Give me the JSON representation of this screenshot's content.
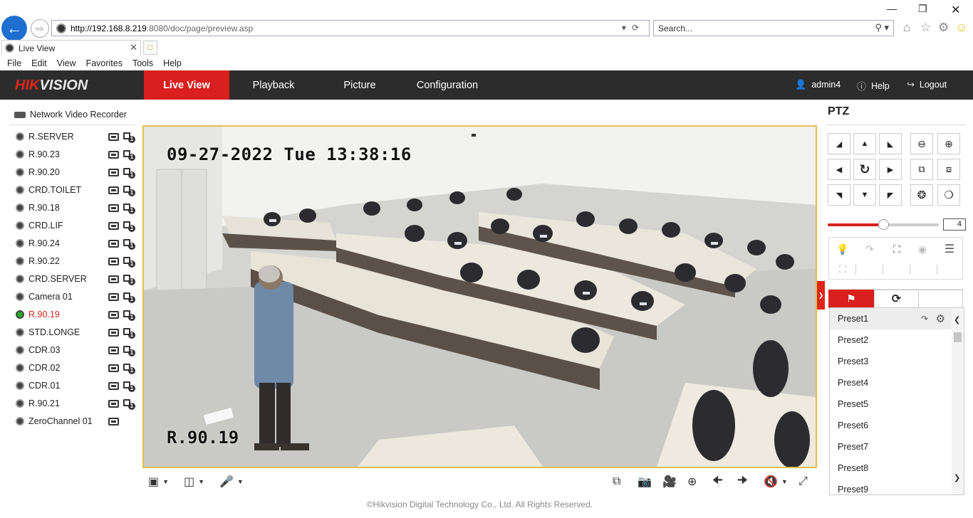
{
  "browser": {
    "url_host": "http://192.168.8.219",
    "url_rest": ":8080/doc/page/preview.asp",
    "search_placeholder": "Search...",
    "tab_title": "Live View",
    "menu": [
      "File",
      "Edit",
      "View",
      "Favorites",
      "Tools",
      "Help"
    ]
  },
  "header": {
    "logo_hik": "HIK",
    "logo_vision": "VISION",
    "tabs": [
      "Live View",
      "Playback",
      "Picture",
      "Configuration"
    ],
    "user": "admin4",
    "help": "Help",
    "logout": "Logout"
  },
  "device_tree": {
    "root": "Network Video Recorder",
    "cameras": [
      {
        "name": "R.SERVER",
        "active": false
      },
      {
        "name": "R.90.23",
        "active": false
      },
      {
        "name": "R.90.20",
        "active": false
      },
      {
        "name": "CRD.TOILET",
        "active": false
      },
      {
        "name": "R.90.18",
        "active": false
      },
      {
        "name": "CRD.LIF",
        "active": false
      },
      {
        "name": "R.90.24",
        "active": false
      },
      {
        "name": "R.90.22",
        "active": false
      },
      {
        "name": "CRD.SERVER",
        "active": false
      },
      {
        "name": "Camera 01",
        "active": false
      },
      {
        "name": "R.90.19",
        "active": true
      },
      {
        "name": "STD.LONGE",
        "active": false
      },
      {
        "name": "CDR.03",
        "active": false
      },
      {
        "name": "CDR.02",
        "active": false
      },
      {
        "name": "CDR.01",
        "active": false
      },
      {
        "name": "R.90.21",
        "active": false
      },
      {
        "name": "ZeroChannel 01",
        "active": false
      }
    ]
  },
  "video": {
    "osd_time": "09-27-2022 Tue 13:38:16",
    "osd_name": "R.90.19"
  },
  "footer": "©Hikvision Digital Technology Co., Ltd. All Rights Reserved.",
  "ptz": {
    "title": "PTZ",
    "speed": 4,
    "speed_max": 7,
    "presets": [
      "Preset1",
      "Preset2",
      "Preset3",
      "Preset4",
      "Preset5",
      "Preset6",
      "Preset7",
      "Preset8",
      "Preset9"
    ],
    "selected_preset": "Preset1"
  }
}
